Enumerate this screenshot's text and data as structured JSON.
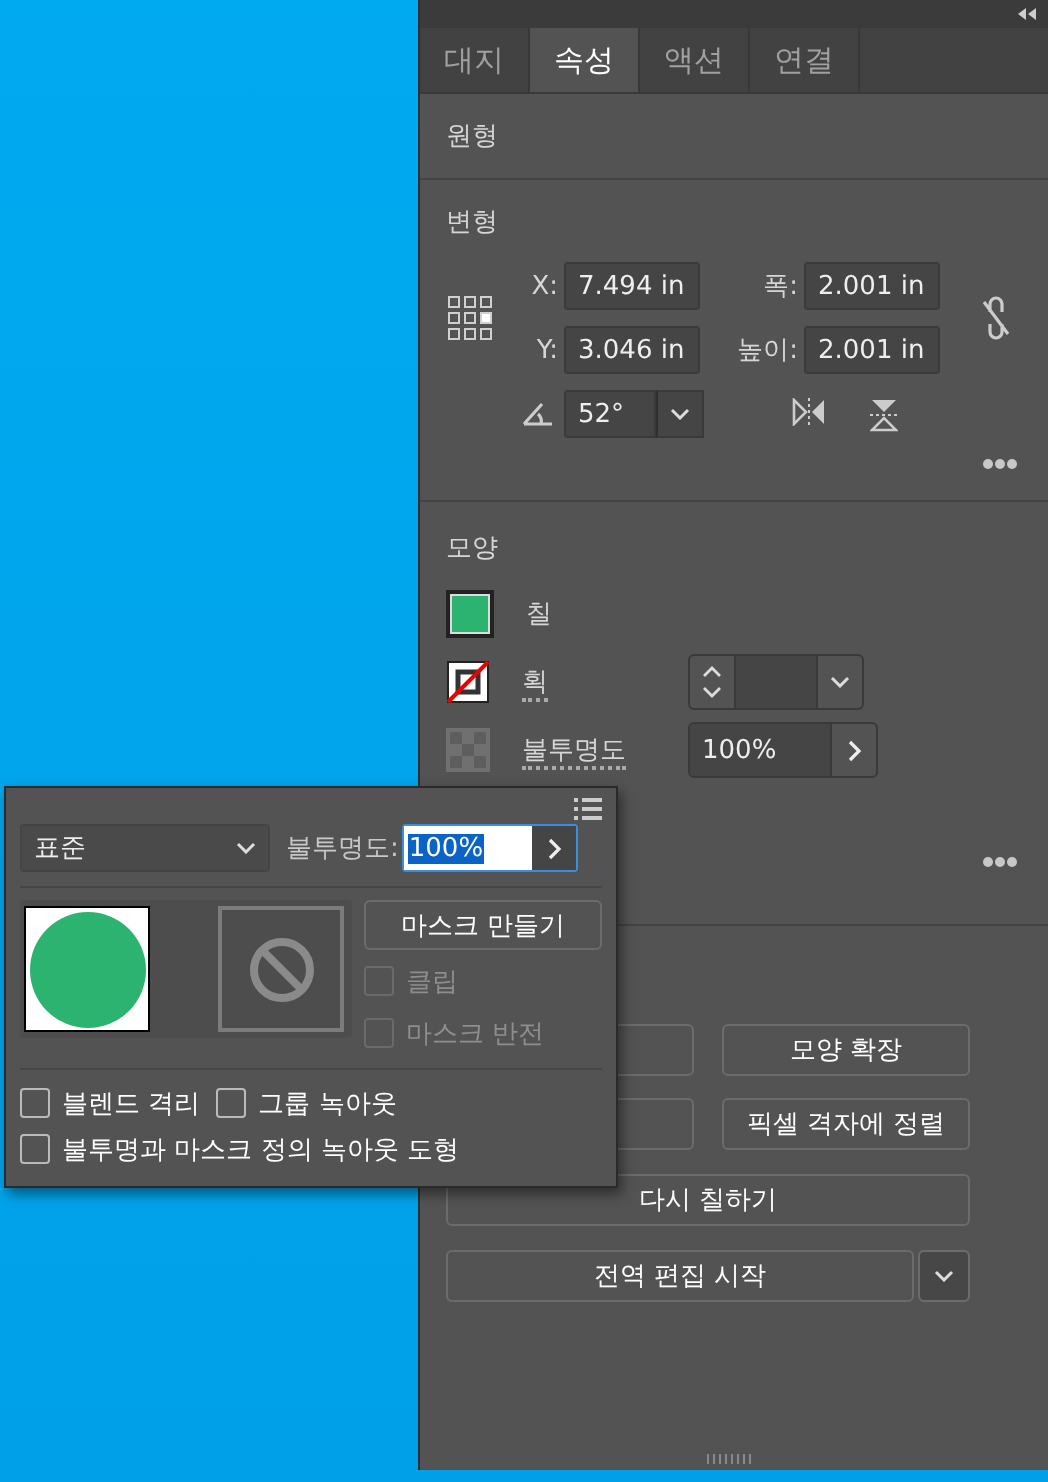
{
  "tabs": [
    {
      "label": "대지",
      "selected": false
    },
    {
      "label": "속성",
      "selected": true
    },
    {
      "label": "액션",
      "selected": false
    },
    {
      "label": "연결",
      "selected": false
    }
  ],
  "appearance_section": {
    "title": "원형"
  },
  "transform": {
    "title": "변형",
    "fields": [
      {
        "label": "X:",
        "value": "7.494 in"
      },
      {
        "label": "폭:",
        "value": "2.001 in"
      },
      {
        "label": "Y:",
        "value": "3.046 in"
      },
      {
        "label": "높이:",
        "value": "2.001 in"
      }
    ],
    "angle": {
      "value": "52°"
    }
  },
  "look": {
    "title": "모양",
    "fill": {
      "label": "칠",
      "color": "#2db370"
    },
    "stroke": {
      "label": "획"
    },
    "opacity": {
      "label": "불투명도",
      "value": "100%"
    }
  },
  "quick_actions": {
    "buttons": [
      {
        "label": "모양 확장",
        "kind": "half"
      },
      {
        "label": "픽셀 격자에 정렬",
        "kind": "half"
      },
      {
        "label": "다시 칠하기",
        "kind": "full"
      },
      {
        "label": "전역 편집 시작",
        "kind": "menu"
      }
    ]
  },
  "popup": {
    "blend_mode": "표준",
    "opacity_label": "불투명도:",
    "opacity_value": "100%",
    "value_selected": true,
    "make_mask": "마스크 만들기",
    "mask_options": [
      {
        "label": "클립",
        "checked": false,
        "disabled": true
      },
      {
        "label": "마스크 반전",
        "checked": false,
        "disabled": true
      }
    ],
    "options": [
      {
        "label": "블렌드 격리",
        "checked": false
      },
      {
        "label": "그룹 녹아웃",
        "checked": false
      },
      {
        "label": "불투명과 마스크 정의 녹아웃 도형",
        "checked": false
      }
    ]
  }
}
